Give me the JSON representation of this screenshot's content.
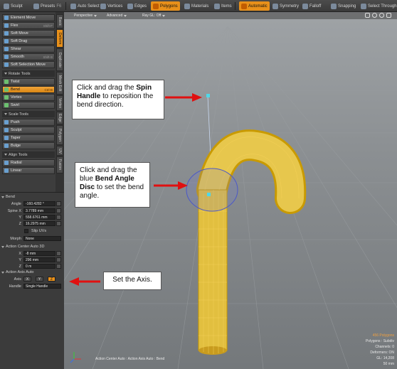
{
  "toolbar": {
    "sculpt": "Sculpt",
    "presets": "Presets",
    "presets_key": "F6",
    "auto_select": "Auto Select",
    "vertices": "Vertices",
    "edges": "Edges",
    "polygons": "Polygons",
    "materials": "Materials",
    "items": "Items",
    "automatic": "Automatic",
    "symmetry": "Symmetry",
    "falloff": "Falloff",
    "snapping": "Snapping",
    "select_through": "Select Through"
  },
  "tools": {
    "element_move": "Element Move",
    "flex": "Flex",
    "flex_key": "Shift-F",
    "soft_move": "Soft Move",
    "soft_drag": "Soft Drag",
    "shear": "Shear",
    "smooth": "Smooth",
    "smooth_key": "Shift-S",
    "soft_selection_move": "Soft Selection Move",
    "rotate_tools": "Rotate Tools",
    "twist": "Twist",
    "bend": "Bend",
    "bend_key": "Ctrl-B",
    "vortex": "Vortex",
    "swirl": "Swirl",
    "scale_tools": "Scale Tools",
    "push": "Push",
    "sculpt": "Sculpt",
    "taper": "Taper",
    "bulge": "Bulge",
    "align_tools": "Align Tools",
    "radial": "Radial",
    "linear": "Linear"
  },
  "vtabs": [
    "Basic",
    "Deform",
    "Duplicate",
    "Mesh Edit",
    "Vertex",
    "Edge",
    "Polygon",
    "UV",
    "Fusion"
  ],
  "props": {
    "bend_header": "Bend",
    "angle_label": "Angle",
    "angle_value": "-160.4282 °",
    "spine_label": "Spine X",
    "spine_x": "3.7789 mm",
    "y_label": "Y",
    "spine_y": "558.6761 mm",
    "z_label": "Z",
    "spine_z": "16.2975 mm",
    "slip_uvs": "Slip UVs",
    "morph_label": "Morph",
    "morph_value": "None",
    "ac_header": "Action Center Auto 3D",
    "ac_x_label": "X",
    "ac_x": "-8 mm",
    "ac_y_label": "Y",
    "ac_y": "296 mm",
    "ac_z_label": "Z",
    "ac_z": "0 m",
    "axis_header": "Action Axis Auto",
    "axis_label": "Axis",
    "axis_x": "X",
    "axis_y": "Y",
    "axis_z": "Z",
    "handle_label": "Handle",
    "handle_value": "Single Handle"
  },
  "viewport": {
    "view": "Perspective",
    "shading": "Advanced",
    "ray_gl": "Ray GL: Off",
    "status_bar": "Action Center Auto : Action Axis Auto : Bend",
    "info": {
      "polygons": "456 Polygons",
      "subdiv": "Polygons : Subdiv",
      "channels": "Channels: 0",
      "deformers": "Deformers: ON",
      "gl": "GL: 14,208",
      "scale": "50 mm"
    }
  },
  "callouts": {
    "spin_pre": "Click and drag the ",
    "spin_bold": "Spin Handle",
    "spin_post": " to reposition the bend direction.",
    "angle_pre": "Click and drag the blue ",
    "angle_bold": "Bend Angle Disc",
    "angle_post": " to set the bend angle.",
    "axis": "Set the Axis."
  },
  "colors": {
    "accent": "#e8901a",
    "arrow": "#e01010",
    "mesh_wire": "#f2c200",
    "handle": "#4fd8e8"
  }
}
